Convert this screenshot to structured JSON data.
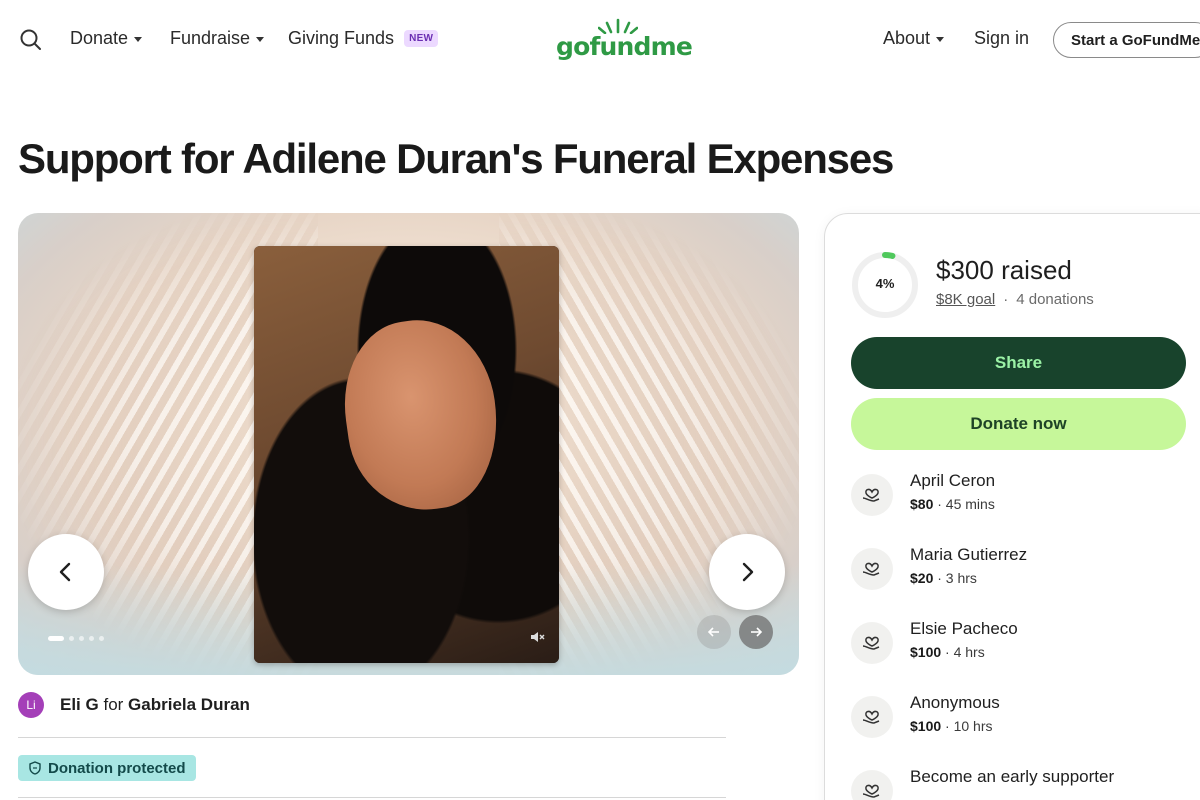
{
  "nav": {
    "donate": "Donate",
    "fundraise": "Fundraise",
    "giving_funds": "Giving Funds",
    "new_badge": "NEW",
    "logo": "gofundme",
    "about": "About",
    "sign_in": "Sign in",
    "start": "Start a GoFundMe"
  },
  "page_title": "Support for Adilene Duran's Funeral Expenses",
  "gallery": {
    "photo_alt": "Photo of Adilene Duran",
    "slide_count": 5,
    "active_slide": 1
  },
  "organizer": {
    "initials": "Li",
    "name": "Eli G",
    "for_word": "for",
    "beneficiary": "Gabriela Duran"
  },
  "protected_label": "Donation protected",
  "progress": {
    "percent_label": "4%",
    "percent_value": 4,
    "raised": "$300 raised",
    "goal": "$8K goal",
    "separator": "·",
    "donations": "4 donations"
  },
  "buttons": {
    "share": "Share",
    "donate_now": "Donate now"
  },
  "donors": [
    {
      "name": "April Ceron",
      "amount": "$80",
      "time": "· 45 mins"
    },
    {
      "name": "Maria Gutierrez",
      "amount": "$20",
      "time": "· 3 hrs"
    },
    {
      "name": "Elsie Pacheco",
      "amount": "$100",
      "time": "· 4 hrs"
    },
    {
      "name": "Anonymous",
      "amount": "$100",
      "time": "· 10 hrs"
    }
  ],
  "early_supporter": {
    "title": "Become an early supporter"
  },
  "colors": {
    "brand_green": "#2f9a45",
    "share_bg": "#18432c",
    "donate_bg": "#c6f79a",
    "protected_bg": "#a8e6e3",
    "avatar_bg": "#a43fb8"
  }
}
